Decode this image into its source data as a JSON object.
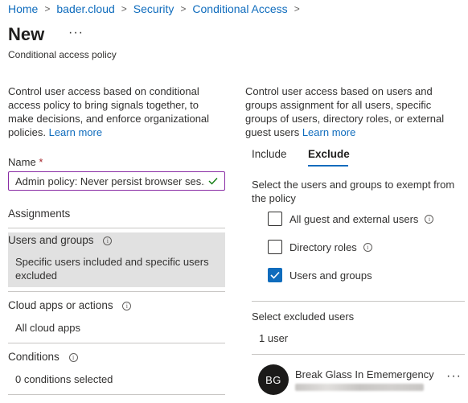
{
  "breadcrumb": {
    "items": [
      "Home",
      "bader.cloud",
      "Security",
      "Conditional Access"
    ],
    "separator": ">"
  },
  "header": {
    "title": "New",
    "more_label": "···",
    "subtitle": "Conditional access policy"
  },
  "left": {
    "description": "Control user access based on conditional access policy to bring signals together, to make decisions, and enforce organizational policies.",
    "learn_more": "Learn more",
    "name_label": "Name",
    "required_marker": "*",
    "name_value": "Admin policy: Never persist browser ses...",
    "assignments_heading": "Assignments",
    "users_groups_label": "Users and groups",
    "users_groups_value": "Specific users included and specific users excluded",
    "cloud_apps_label": "Cloud apps or actions",
    "cloud_apps_value": "All cloud apps",
    "conditions_label": "Conditions",
    "conditions_value": "0 conditions selected"
  },
  "right": {
    "description": "Control user access based on users and groups assignment for all users, specific groups of users, directory roles, or external guest users",
    "learn_more": "Learn more",
    "tabs": [
      {
        "label": "Include",
        "active": false
      },
      {
        "label": "Exclude",
        "active": true
      }
    ],
    "exclude_prompt": "Select the users and groups to exempt from the policy",
    "options": [
      {
        "label": "All guest and external users",
        "checked": false,
        "info": true
      },
      {
        "label": "Directory roles",
        "checked": false,
        "info": true
      },
      {
        "label": "Users and groups",
        "checked": true,
        "info": false
      }
    ],
    "select_excluded_label": "Select excluded users",
    "excluded_count": "1 user",
    "user": {
      "initials": "BG",
      "name": "Break Glass In Ememergency",
      "more_label": "···"
    }
  },
  "colors": {
    "accent": "#0f6cbd",
    "input_border": "#8a2da5",
    "selected_section_bg": "#e1e1e1",
    "avatar_bg": "#1b1a19",
    "success_check": "#107c10"
  },
  "icons": [
    "info-icon",
    "checkmark-icon",
    "chevron-right-icon",
    "more-icon"
  ]
}
